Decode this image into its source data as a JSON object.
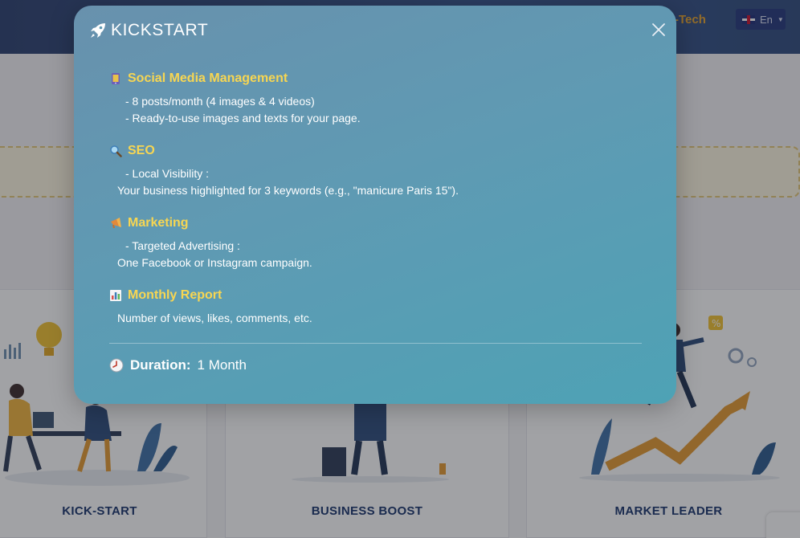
{
  "background": {
    "nav_item": "-Tech",
    "language": "En",
    "cards": [
      {
        "title": "KICK-START"
      },
      {
        "title": "BUSINESS BOOST"
      },
      {
        "title": "MARKET LEADER"
      }
    ]
  },
  "modal": {
    "brand": "KICKSTART",
    "sections": [
      {
        "icon": "mobile-phone-icon",
        "title": "Social Media Management",
        "lines": [
          "- 8 posts/month (4 images & 4 videos)",
          "- Ready-to-use images and texts for your page."
        ]
      },
      {
        "icon": "magnifier-icon",
        "title": "SEO",
        "lines": [
          "- Local Visibility :",
          "Your business highlighted for 3 keywords (e.g., \"manicure Paris 15\")."
        ]
      },
      {
        "icon": "megaphone-icon",
        "title": "Marketing",
        "lines": [
          "- Targeted Advertising :",
          "One Facebook or Instagram campaign."
        ]
      },
      {
        "icon": "bar-chart-icon",
        "title": "Monthly Report",
        "lines": [
          "Number of views, likes, comments, etc."
        ]
      }
    ],
    "duration_label": "Duration:",
    "duration_value": "1 Month"
  },
  "colors": {
    "section_title": "#f7d652",
    "card_title": "#18336b",
    "nav_accent": "#e7a22a"
  }
}
